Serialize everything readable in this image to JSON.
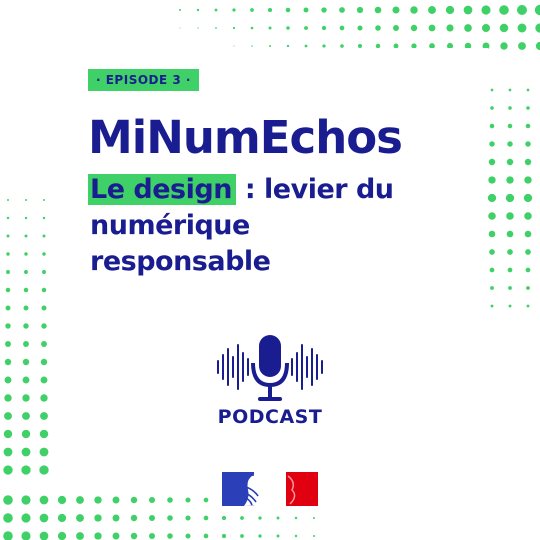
{
  "episode_badge": "· EPISODE 3 ·",
  "title": "MiNumEchos",
  "subtitle": {
    "highlight": "Le design",
    "rest_line1": " : levier du",
    "line2": "numérique",
    "line3": "responsable"
  },
  "podcast_label": "PODCAST",
  "colors": {
    "navy": "#1a1d8f",
    "green": "#3fd167",
    "flag_blue": "#2b3fb8",
    "flag_red": "#e1000f"
  },
  "icons": [
    "microphone-icon",
    "soundwave-icon",
    "marianne-flag-icon"
  ]
}
